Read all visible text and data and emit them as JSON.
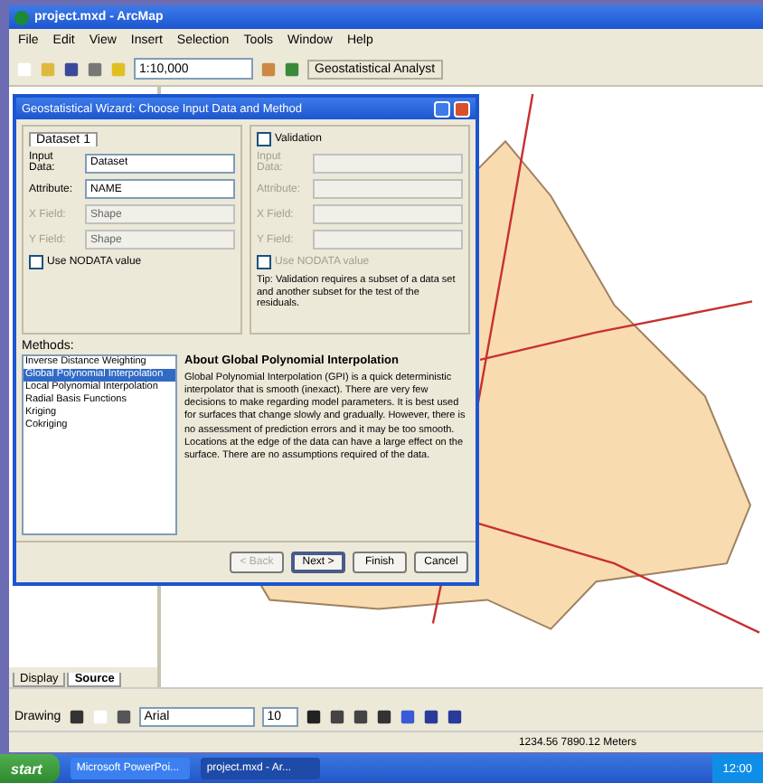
{
  "app_window": {
    "title": "project.mxd - ArcMap"
  },
  "menu": [
    "File",
    "Edit",
    "View",
    "Insert",
    "Selection",
    "Tools",
    "Window",
    "Help"
  ],
  "toolbar": {
    "scale": "1:10,000",
    "extension": "Geostatistical Analyst"
  },
  "dialog": {
    "title": "Geostatistical Wizard: Choose Input Data and Method",
    "dataset_tab": "Dataset 1",
    "fields": [
      {
        "label": "Input Data:",
        "value": "Dataset",
        "disabled": false
      },
      {
        "label": "Attribute:",
        "value": "NAME",
        "disabled": false
      },
      {
        "label": "X Field:",
        "value": "Shape",
        "disabled": true
      },
      {
        "label": "Y Field:",
        "value": "Shape",
        "disabled": true
      }
    ],
    "nodata": {
      "label": "Use NODATA value",
      "checked": false
    },
    "validation": {
      "label": "Validation",
      "checked": false,
      "fields": [
        {
          "label": "Input Data:",
          "disabled": true
        },
        {
          "label": "Attribute:",
          "disabled": true
        },
        {
          "label": "X Field:",
          "disabled": true
        },
        {
          "label": "Y Field:",
          "disabled": true
        }
      ],
      "nodata_label": "Use NODATA value",
      "nodata_checked": false,
      "tip": "Tip: Validation requires a subset of a data set and another subset for the test of the residuals."
    },
    "methods_label": "Methods:",
    "methods": [
      {
        "label": "Inverse Distance Weighting",
        "selected": false
      },
      {
        "label": "Global Polynomial Interpolation",
        "selected": true
      },
      {
        "label": "Local Polynomial Interpolation",
        "selected": false
      },
      {
        "label": "Radial Basis Functions",
        "selected": false
      },
      {
        "label": "Kriging",
        "selected": false
      },
      {
        "label": "Cokriging",
        "selected": false
      }
    ],
    "about_title": "About Global Polynomial Interpolation",
    "about_text": "Global Polynomial Interpolation (GPI) is a quick deterministic interpolator that is smooth (inexact). There are very few decisions to make regarding model parameters. It is best used for surfaces that change slowly and gradually. However, there is no assessment of prediction errors and it may be too smooth. Locations at the edge of the data can have a large effect on the surface. There are no assumptions required of the data.",
    "buttons": [
      {
        "label": "< Back",
        "disabled": true,
        "default": false
      },
      {
        "label": "Next >",
        "disabled": false,
        "default": true
      },
      {
        "label": "Finish",
        "disabled": false,
        "default": false
      },
      {
        "label": "Cancel",
        "disabled": false,
        "default": false
      }
    ]
  },
  "toc_tabs": [
    {
      "label": "Display",
      "selected": false
    },
    {
      "label": "Source",
      "selected": true
    }
  ],
  "draw_toolbar": {
    "drawing": "Drawing",
    "font": "Arial",
    "size": "10"
  },
  "status_bar": "1234.56  7890.12 Meters",
  "taskbar": {
    "start": "start",
    "tasks": [
      {
        "label": "Microsoft PowerPoi...",
        "selected": false
      },
      {
        "label": "project.mxd - Ar...",
        "selected": true
      }
    ],
    "clock": "12:00"
  }
}
